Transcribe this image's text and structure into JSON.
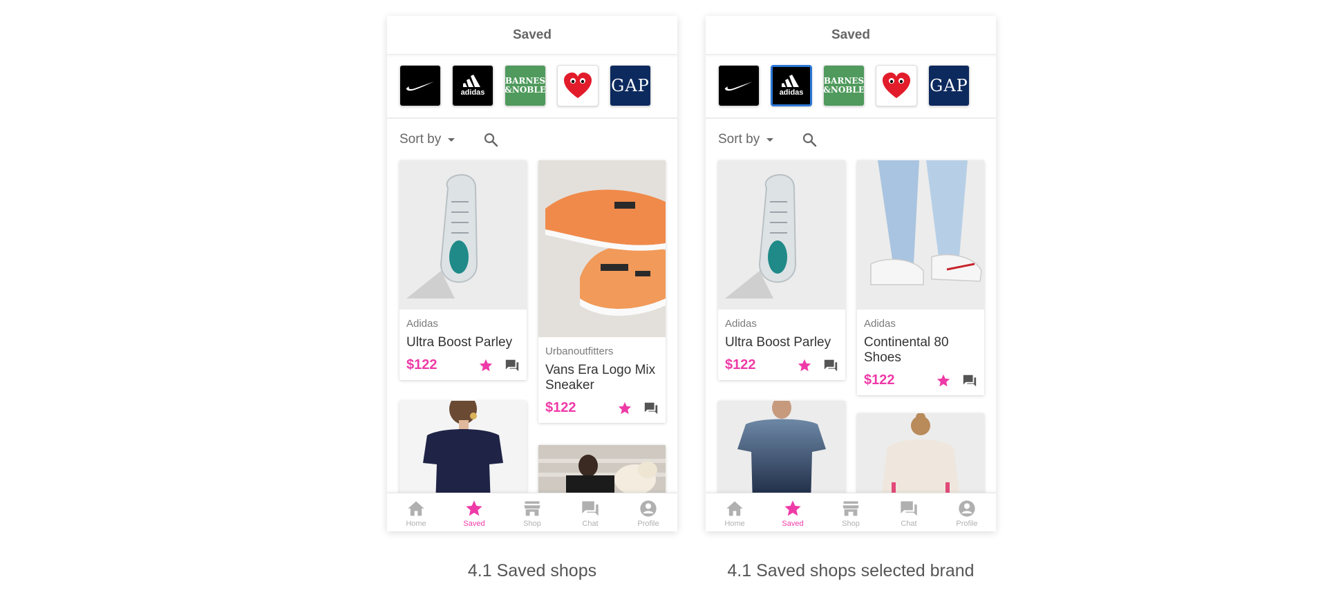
{
  "screens": [
    {
      "title": "Saved",
      "brands": [
        {
          "name": "Nike",
          "icon": "nike-logo",
          "selected": false
        },
        {
          "name": "Adidas",
          "icon": "adidas-logo",
          "wordmark": "adidas",
          "selected": false
        },
        {
          "name": "Barnes & Noble",
          "icon": "barnes-noble-logo",
          "line1": "BARNES",
          "line2": "&NOBLE",
          "selected": false
        },
        {
          "name": "Comme des Garcons",
          "icon": "heart-eyes-logo",
          "selected": false
        },
        {
          "name": "GAP",
          "icon": "gap-logo",
          "wordmark": "GAP",
          "selected": false
        }
      ],
      "sort_label": "Sort by",
      "products": [
        {
          "brand": "Adidas",
          "title": "Ultra Boost Parley",
          "price": "$122",
          "image": "white-sneaker-top-view"
        },
        {
          "brand": "Urbanoutfitters",
          "title": "Vans Era Logo Mix Sneaker",
          "price": "$122",
          "image": "orange-vans-sneakers"
        },
        {
          "image": "navy-ruffle-top"
        },
        {
          "image": "woman-with-dog"
        }
      ],
      "nav": [
        {
          "label": "Home",
          "icon": "home-icon",
          "active": false
        },
        {
          "label": "Saved",
          "icon": "star-icon",
          "active": true
        },
        {
          "label": "Shop",
          "icon": "store-icon",
          "active": false
        },
        {
          "label": "Chat",
          "icon": "chat-icon",
          "active": false
        },
        {
          "label": "Profile",
          "icon": "profile-icon",
          "active": false
        }
      ],
      "caption": "4.1 Saved shops"
    },
    {
      "title": "Saved",
      "brands": [
        {
          "name": "Nike",
          "icon": "nike-logo",
          "selected": false
        },
        {
          "name": "Adidas",
          "icon": "adidas-logo",
          "wordmark": "adidas",
          "selected": true
        },
        {
          "name": "Barnes & Noble",
          "icon": "barnes-noble-logo",
          "line1": "BARNES",
          "line2": "&NOBLE",
          "selected": false
        },
        {
          "name": "Comme des Garcons",
          "icon": "heart-eyes-logo",
          "selected": false
        },
        {
          "name": "GAP",
          "icon": "gap-logo",
          "wordmark": "GAP",
          "selected": false
        }
      ],
      "sort_label": "Sort by",
      "products": [
        {
          "brand": "Adidas",
          "title": "Ultra Boost Parley",
          "price": "$122",
          "image": "white-sneaker-top-view"
        },
        {
          "brand": "Adidas",
          "title": "Continental 80 Shoes",
          "price": "$122",
          "image": "white-sneakers-jogger-pants"
        },
        {
          "image": "blue-gradient-tee"
        },
        {
          "image": "white-hoodie-back"
        }
      ],
      "nav": [
        {
          "label": "Home",
          "icon": "home-icon",
          "active": false
        },
        {
          "label": "Saved",
          "icon": "star-icon",
          "active": true
        },
        {
          "label": "Shop",
          "icon": "store-icon",
          "active": false
        },
        {
          "label": "Chat",
          "icon": "chat-icon",
          "active": false
        },
        {
          "label": "Profile",
          "icon": "profile-icon",
          "active": false
        }
      ],
      "caption": "4.1 Saved shops selected brand"
    }
  ],
  "colors": {
    "accent": "#ee3aa7",
    "selected_border": "#2b77d6",
    "inactive_nav": "#b0b0b0"
  }
}
